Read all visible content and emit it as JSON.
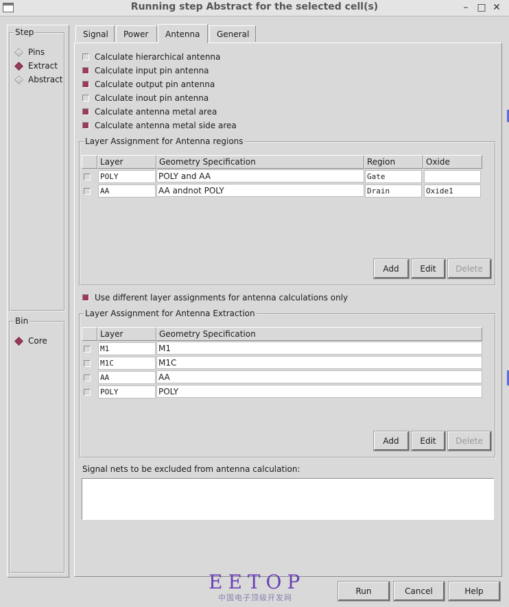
{
  "window": {
    "title": "Running step Abstract for the selected cell(s)",
    "minimize": "–",
    "maximize": "□",
    "close": "✕"
  },
  "step_group": {
    "label": "Step",
    "options": [
      {
        "label": "Pins",
        "selected": false
      },
      {
        "label": "Extract",
        "selected": true
      },
      {
        "label": "Abstract",
        "selected": false
      }
    ]
  },
  "bin_group": {
    "label": "Bin",
    "options": [
      {
        "label": "Core",
        "selected": true
      }
    ]
  },
  "tabs": [
    {
      "label": "Signal",
      "active": false
    },
    {
      "label": "Power",
      "active": false
    },
    {
      "label": "Antenna",
      "active": true
    },
    {
      "label": "General",
      "active": false
    }
  ],
  "antenna": {
    "checks": [
      {
        "label": "Calculate hierarchical antenna",
        "checked": false
      },
      {
        "label": "Calculate input pin antenna",
        "checked": true
      },
      {
        "label": "Calculate output pin antenna",
        "checked": true
      },
      {
        "label": "Calculate inout pin antenna",
        "checked": false
      },
      {
        "label": "Calculate antenna metal area",
        "checked": true
      },
      {
        "label": "Calculate antenna metal side area",
        "checked": true
      }
    ],
    "regions": {
      "label": "Layer Assignment for Antenna regions",
      "headers": {
        "layer": "Layer",
        "geometry": "Geometry Specification",
        "region": "Region",
        "oxide": "Oxide"
      },
      "rows": [
        {
          "layer": "POLY",
          "geometry": "POLY and AA",
          "region": "Gate",
          "oxide": ""
        },
        {
          "layer": "AA",
          "geometry": "AA andnot POLY",
          "region": "Drain",
          "oxide": "Oxide1"
        }
      ],
      "buttons": {
        "add": "Add",
        "edit": "Edit",
        "delete": "Delete"
      }
    },
    "use_different": {
      "label": "Use different layer assignments for antenna calculations only",
      "checked": true
    },
    "extraction": {
      "label": "Layer Assignment for Antenna Extraction",
      "headers": {
        "layer": "Layer",
        "geometry": "Geometry Specification"
      },
      "rows": [
        {
          "layer": "M1",
          "geometry": "M1"
        },
        {
          "layer": "M1C",
          "geometry": "M1C"
        },
        {
          "layer": "AA",
          "geometry": "AA"
        },
        {
          "layer": "POLY",
          "geometry": "POLY"
        }
      ],
      "buttons": {
        "add": "Add",
        "edit": "Edit",
        "delete": "Delete"
      }
    },
    "excluded_nets": {
      "label": "Signal nets to be excluded from antenna calculation:",
      "value": ""
    }
  },
  "footer": {
    "run": "Run",
    "cancel": "Cancel",
    "help": "Help"
  },
  "watermark": {
    "brand": "EETOP",
    "subtitle": "中国电子顶级开发网"
  },
  "colors": {
    "accent": "#9b3a5c",
    "background": "#d9d9d9",
    "watermark": "#6a3fb4"
  }
}
